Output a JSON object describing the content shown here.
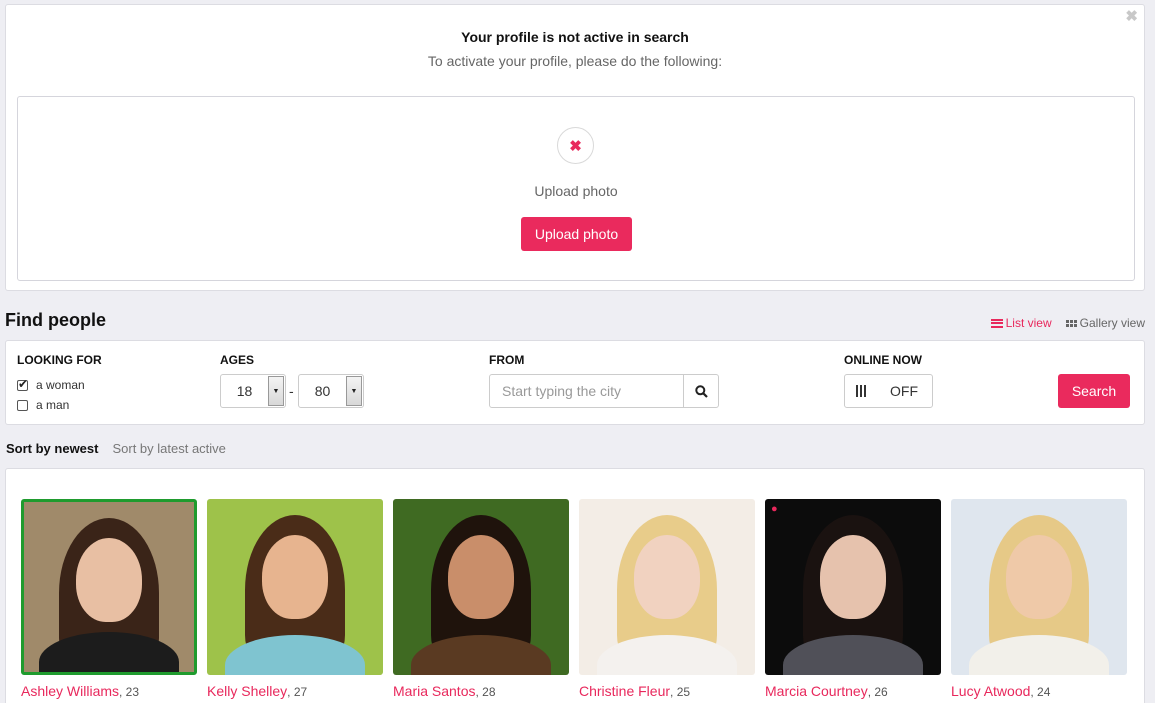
{
  "notice": {
    "close_symbol": "✖",
    "title": "Your profile is not active in search",
    "subtitle": "To activate your profile, please do the following:",
    "status_symbol": "✖",
    "step_label": "Upload photo",
    "button_label": "Upload photo"
  },
  "find": {
    "title": "Find people",
    "list_view": "List view",
    "gallery_view": "Gallery view"
  },
  "filters": {
    "looking_for_label": "LOOKING FOR",
    "options": [
      {
        "label": "a woman",
        "checked": true
      },
      {
        "label": "a man",
        "checked": false
      }
    ],
    "ages_label": "AGES",
    "age_min": "18",
    "age_max": "80",
    "age_separator": "-",
    "from_label": "FROM",
    "city_placeholder": "Start typing the city",
    "online_label": "ONLINE NOW",
    "online_state": "OFF",
    "search_button": "Search"
  },
  "sort": {
    "active": "Sort by newest",
    "other": "Sort by latest active"
  },
  "colors": {
    "accent": "#ea2a5d",
    "selected_border": "#1f9b2e"
  },
  "profiles": [
    {
      "name": "Ashley Williams",
      "age": ", 23",
      "selected": true,
      "bg": "#a08a6a",
      "hair": "#3a2418",
      "skin": "#e8bfa3",
      "top": "#1c1c1c",
      "pin": false
    },
    {
      "name": "Kelly Shelley",
      "age": ", 27",
      "selected": false,
      "bg": "#9ec24a",
      "hair": "#4a2c18",
      "skin": "#e7b48f",
      "top": "#7fc4d0",
      "pin": false
    },
    {
      "name": "Maria Santos",
      "age": ", 28",
      "selected": false,
      "bg": "#3f6a22",
      "hair": "#1f130c",
      "skin": "#c98e6a",
      "top": "#5a3a22",
      "pin": false
    },
    {
      "name": "Christine Fleur",
      "age": ", 25",
      "selected": false,
      "bg": "#f3ede6",
      "hair": "#e8cc8a",
      "skin": "#f1d2c0",
      "top": "#f4f1ee",
      "pin": false
    },
    {
      "name": "Marcia Courtney",
      "age": ", 26",
      "selected": false,
      "bg": "#0c0c0c",
      "hair": "#1a1210",
      "skin": "#e6c2ad",
      "top": "#505058",
      "pin": true
    },
    {
      "name": "Lucy Atwood",
      "age": ", 24",
      "selected": false,
      "bg": "#dfe6ee",
      "hair": "#e6c987",
      "skin": "#efc9a8",
      "top": "#f2f0ea",
      "pin": false
    }
  ]
}
